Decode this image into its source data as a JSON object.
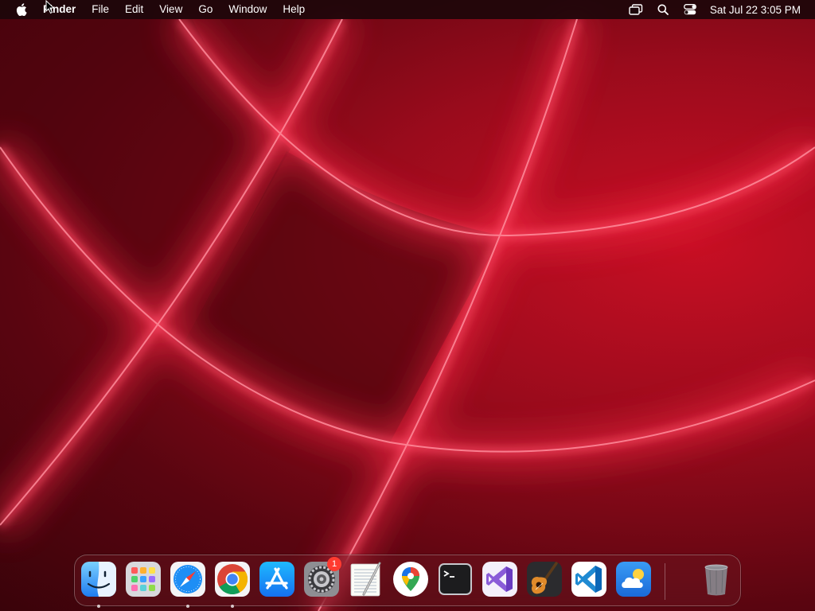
{
  "menubar": {
    "app_name": "Finder",
    "menus": [
      "File",
      "Edit",
      "View",
      "Go",
      "Window",
      "Help"
    ],
    "status_icons": [
      "screen-mirroring-icon",
      "spotlight-search-icon",
      "control-center-icon"
    ],
    "clock": "Sat Jul 22  3:05 PM"
  },
  "dock": {
    "apps": [
      {
        "name": "Finder",
        "icon": "finder-icon",
        "running": true
      },
      {
        "name": "Launchpad",
        "icon": "launchpad-icon",
        "running": false
      },
      {
        "name": "Safari",
        "icon": "safari-icon",
        "running": true
      },
      {
        "name": "Google Chrome",
        "icon": "chrome-icon",
        "running": true
      },
      {
        "name": "App Store",
        "icon": "app-store-icon",
        "running": false
      },
      {
        "name": "System Settings",
        "icon": "system-settings-icon",
        "running": false,
        "badge": "1"
      },
      {
        "name": "TextEdit",
        "icon": "textedit-icon",
        "running": false
      },
      {
        "name": "Google Maps",
        "icon": "google-maps-icon",
        "running": false
      },
      {
        "name": "Terminal",
        "icon": "terminal-icon",
        "running": false
      },
      {
        "name": "Visual Studio",
        "icon": "visual-studio-icon",
        "running": false
      },
      {
        "name": "GarageBand",
        "icon": "garageband-icon",
        "running": false
      },
      {
        "name": "Visual Studio Code",
        "icon": "vscode-icon",
        "running": false
      },
      {
        "name": "Weather",
        "icon": "weather-icon",
        "running": false
      }
    ],
    "trash": {
      "name": "Trash",
      "icon": "trash-icon"
    }
  },
  "colors": {
    "wallpaper_base": "#9a0b1c",
    "wallpaper_glow": "#ff3a55",
    "menubar_bg": "#1c060a",
    "badge": "#ff3b30"
  }
}
